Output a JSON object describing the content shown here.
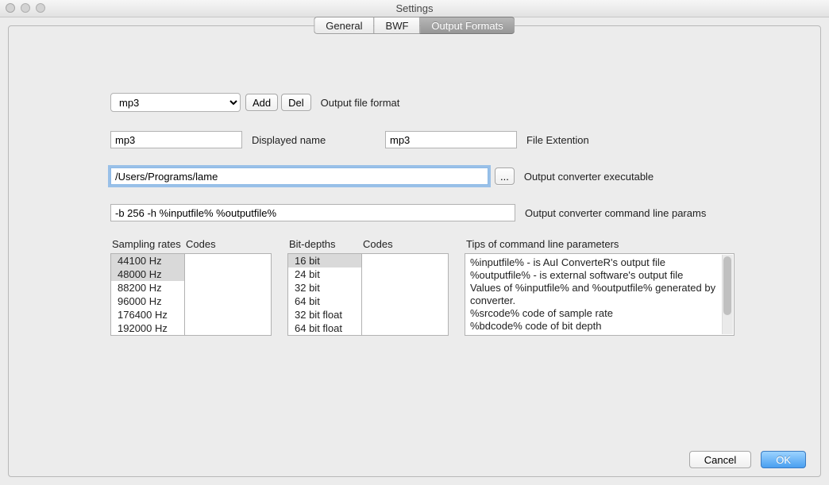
{
  "window": {
    "title": "Settings"
  },
  "tabs": {
    "general": "General",
    "bwf": "BWF",
    "output": "Output Formats"
  },
  "format": {
    "select_value": "mp3",
    "add_btn": "Add",
    "del_btn": "Del",
    "label": "Output file format"
  },
  "displayed_name": {
    "value": "mp3",
    "label": "Displayed name"
  },
  "file_ext": {
    "value": "mp3",
    "label": "File Extention"
  },
  "exe_path": {
    "value": "/Users/Programs/lame",
    "browse": "...",
    "label": "Output converter executable"
  },
  "cmd_params": {
    "value": "-b 256 -h %inputfile% %outputfile%",
    "label": "Output converter command line params"
  },
  "sampling": {
    "header": "Sampling rates",
    "codes_header": "Codes",
    "rows": [
      "44100 Hz",
      "48000 Hz",
      "88200 Hz",
      "96000 Hz",
      "176400 Hz",
      "192000 Hz"
    ],
    "selected": [
      0,
      1
    ]
  },
  "bitdepths": {
    "header": "Bit-depths",
    "codes_header": "Codes",
    "rows": [
      "16 bit",
      "24 bit",
      "32 bit",
      "64 bit",
      "32 bit float",
      "64 bit float"
    ],
    "selected": [
      0
    ]
  },
  "tips": {
    "header": "Tips of command line parameters",
    "lines": [
      "%inputfile% - is AuI ConverteR's output file",
      "%outputfile% - is external software's output file",
      "Values of %inputfile% and %outputfile% generated by converter.",
      "%srcode% code of sample rate",
      "%bdcode% code of bit depth"
    ]
  },
  "footer": {
    "cancel": "Cancel",
    "ok": "OK"
  }
}
